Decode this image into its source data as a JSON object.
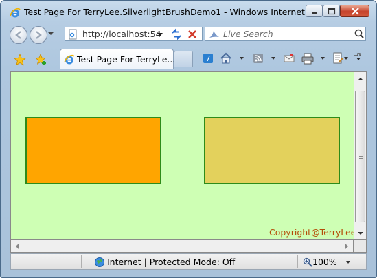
{
  "window": {
    "title": "Test Page For TerryLee.SilverlightBrushDemo1 - Windows Internet Ex..."
  },
  "navigation": {
    "address_value": "http://localhost:54",
    "search_placeholder": "Live Search"
  },
  "tabs": [
    {
      "label": "Test Page For TerryLe..."
    }
  ],
  "content": {
    "copyright": "Copyright@TerryLee",
    "background_color": "#ceffb4",
    "rect1_fill": "#ffa500",
    "rect2_fill": "#e3d15c",
    "rect_stroke": "#2e8b1a"
  },
  "statusbar": {
    "zone_text": "Internet | Protected Mode: Off",
    "zoom_text": "100%"
  },
  "icons": {
    "app": "ie-icon",
    "back": "back-arrow-icon",
    "forward": "forward-arrow-icon",
    "refresh": "refresh-icon",
    "stop": "stop-icon",
    "search": "magnifier-icon",
    "favorites": "star-icon",
    "add_favorites": "add-favorite-icon",
    "home": "home-icon",
    "feeds": "rss-icon",
    "print": "printer-icon",
    "page": "page-icon",
    "globe": "globe-icon"
  }
}
